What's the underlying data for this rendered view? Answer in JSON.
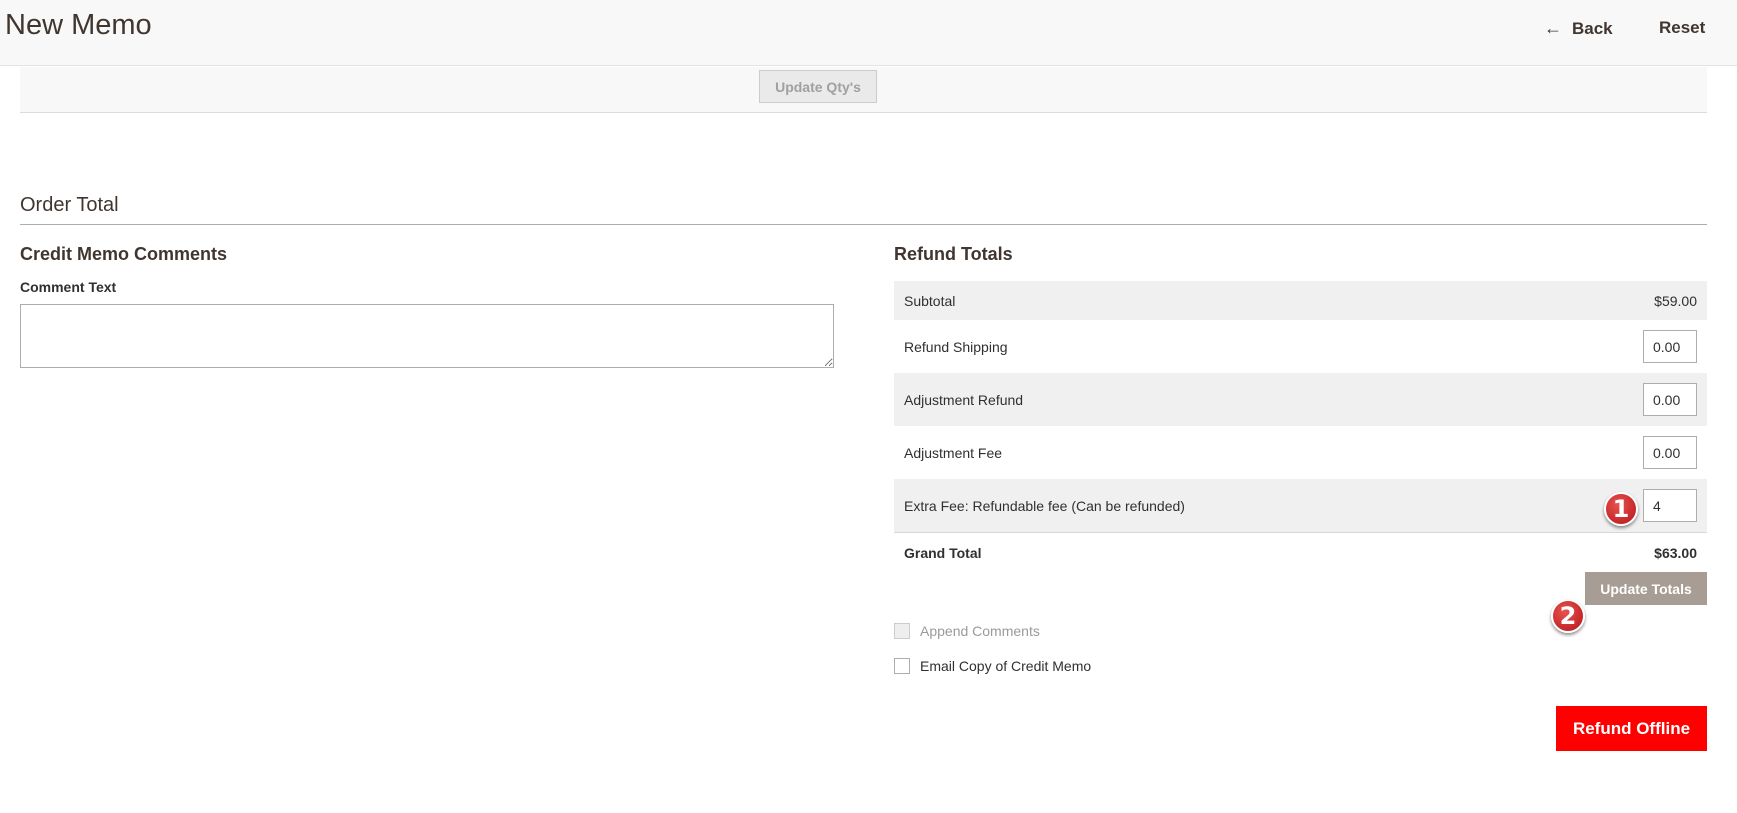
{
  "header": {
    "title": "New Memo",
    "back_icon": "←",
    "back_label": "Back",
    "reset_label": "Reset"
  },
  "qty_bar": {
    "update_qty_label": "Update Qty's"
  },
  "order_total": {
    "title": "Order Total"
  },
  "comments": {
    "title": "Credit Memo Comments",
    "comment_label": "Comment Text",
    "comment_value": ""
  },
  "refund_totals": {
    "title": "Refund Totals",
    "subtotal_label": "Subtotal",
    "subtotal_value": "$59.00",
    "refund_shipping_label": "Refund Shipping",
    "refund_shipping_value": "0.00",
    "adjustment_refund_label": "Adjustment Refund",
    "adjustment_refund_value": "0.00",
    "adjustment_fee_label": "Adjustment Fee",
    "adjustment_fee_value": "0.00",
    "extra_fee_label": "Extra Fee: Refundable fee (Can be refunded)",
    "extra_fee_value": "4",
    "grand_total_label": "Grand Total",
    "grand_total_value": "$63.00",
    "update_totals_label": "Update Totals"
  },
  "options": {
    "append_comments_label": "Append Comments",
    "append_comments_checked": false,
    "email_copy_label": "Email Copy of Credit Memo",
    "email_copy_checked": false
  },
  "actions": {
    "refund_offline_label": "Refund Offline"
  },
  "annotations": {
    "badge_1": "1",
    "badge_2": "2"
  },
  "colors": {
    "accent": "#ff0000",
    "update_totals": "#a79d95",
    "badge": "#c71b21"
  }
}
